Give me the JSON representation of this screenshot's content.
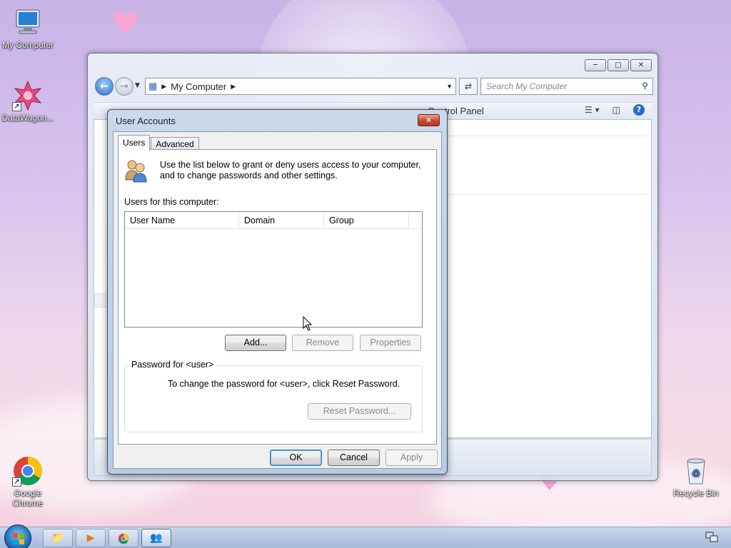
{
  "desktop": {
    "icons": [
      {
        "label": "My Computer"
      },
      {
        "label": "DataWagon..."
      },
      {
        "label": "Google Chrome"
      },
      {
        "label": "Recycle Bin"
      }
    ]
  },
  "explorer": {
    "address": "My Computer",
    "search_placeholder": "Search My Computer",
    "cmdbar_visible_text": "Control Panel"
  },
  "dialog": {
    "title": "User Accounts",
    "tabs": [
      {
        "label": "Users",
        "active": true
      },
      {
        "label": "Advanced",
        "active": false
      }
    ],
    "intro_text": "Use the list below to grant or deny users access to your computer, and to change passwords and other settings.",
    "users_label": "Users for this computer:",
    "columns": [
      "User Name",
      "Domain",
      "Group"
    ],
    "rows": [],
    "buttons": {
      "add": "Add...",
      "remove": "Remove",
      "properties": "Properties",
      "reset_password": "Reset Password...",
      "ok": "OK",
      "cancel": "Cancel",
      "apply": "Apply"
    },
    "password_group_label": "Password for <user>",
    "password_text": "To change the password for <user>, click Reset Password."
  },
  "colors": {
    "accent": "#3c7fb1",
    "close_button": "#c6472f",
    "wallpaper_top": "#c7b3e6",
    "wallpaper_bottom": "#f3cfe0"
  }
}
